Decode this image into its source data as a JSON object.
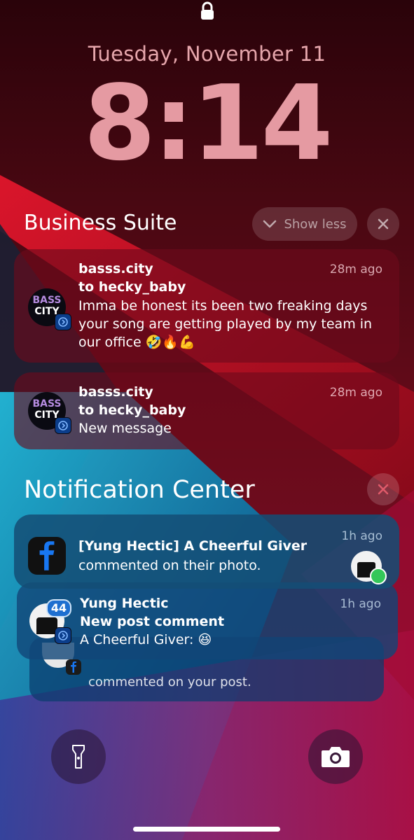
{
  "lockscreen": {
    "date": "Tuesday, November 11",
    "time": "8:14"
  },
  "business_suite": {
    "title": "Business Suite",
    "show_less": "Show less",
    "notifications": [
      {
        "sender": "basss.city",
        "subtitle": "to hecky_baby",
        "time": "28m ago",
        "body": "Imma be honest its been two freaking days your song are getting played by my team in our office 🤣🔥💪"
      },
      {
        "sender": "basss.city",
        "subtitle": "to hecky_baby",
        "time": "28m ago",
        "body": "New message"
      }
    ],
    "avatar_text": [
      "BASS",
      "CITY"
    ]
  },
  "notification_center": {
    "title": "Notification Center",
    "notifications": [
      {
        "app": "facebook",
        "title": "[Yung Hectic] A Cheerful Giver",
        "body": "commented on their photo.",
        "time": "1h ago"
      },
      {
        "app": "business-suite",
        "count_badge": "44",
        "sender": "Yung Hectic",
        "subtitle": "New post comment",
        "body": "A Cheerful Giver: 😆",
        "time": "1h ago"
      },
      {
        "app": "facebook",
        "body": "commented on your post."
      }
    ]
  },
  "colors": {
    "accent_red": "#c0102a",
    "facebook_blue": "#1877f2"
  }
}
